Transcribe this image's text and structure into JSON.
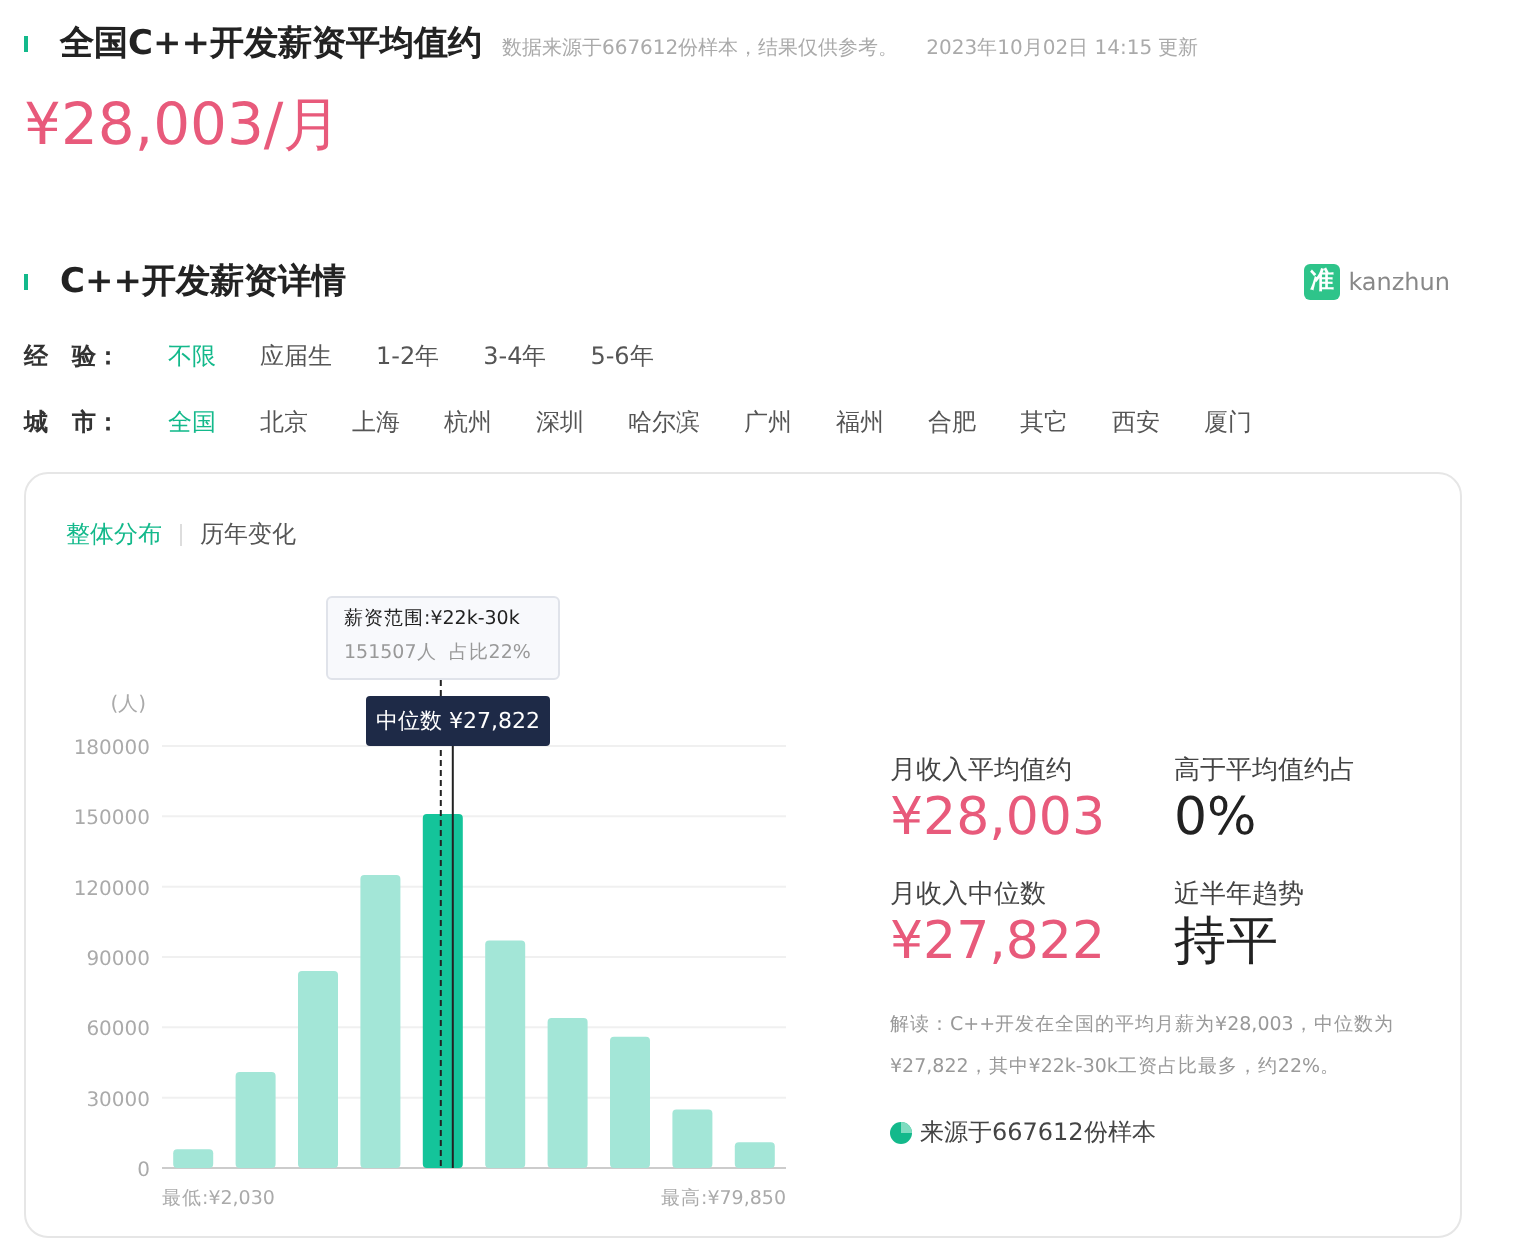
{
  "header": {
    "title": "全国C++开发薪资平均值约",
    "source_note": "数据来源于667612份样本，结果仅供参考。",
    "updated": "2023年10月02日 14:15 更新",
    "salary": "¥28,003/月"
  },
  "details": {
    "title": "C++开发薪资详情",
    "brand_icon": "准",
    "brand": "kanzhun",
    "filters": [
      {
        "label": "经　验：",
        "options": [
          {
            "label": "不限",
            "selected": true
          },
          {
            "label": "应届生",
            "selected": false
          },
          {
            "label": "1-2年",
            "selected": false
          },
          {
            "label": "3-4年",
            "selected": false
          },
          {
            "label": "5-6年",
            "selected": false
          }
        ]
      },
      {
        "label": "城　市：",
        "options": [
          {
            "label": "全国",
            "selected": true
          },
          {
            "label": "北京",
            "selected": false
          },
          {
            "label": "上海",
            "selected": false
          },
          {
            "label": "杭州",
            "selected": false
          },
          {
            "label": "深圳",
            "selected": false
          },
          {
            "label": "哈尔滨",
            "selected": false
          },
          {
            "label": "广州",
            "selected": false
          },
          {
            "label": "福州",
            "selected": false
          },
          {
            "label": "合肥",
            "selected": false
          },
          {
            "label": "其它",
            "selected": false
          },
          {
            "label": "西安",
            "selected": false
          },
          {
            "label": "厦门",
            "selected": false
          }
        ]
      }
    ]
  },
  "card": {
    "tabs": [
      {
        "label": "整体分布",
        "selected": true
      },
      {
        "label": "历年变化",
        "selected": false
      }
    ],
    "distribution": {
      "tooltip_title": "薪资范围:¥22k-30k",
      "tooltip_detail": "151507人  占比22%",
      "median_label": "中位数 ¥27,822",
      "min_label": "最低:¥2,030",
      "max_label": "最高:¥79,850",
      "chart_data": {
        "type": "bar",
        "ylabel": "(人)",
        "values": [
          8000,
          41000,
          84000,
          125000,
          151000,
          97000,
          64000,
          56000,
          25000,
          11000
        ],
        "ylim": [
          0,
          180000
        ],
        "yticks": [
          0,
          30000,
          60000,
          90000,
          120000,
          150000,
          180000
        ],
        "grid": true
      }
    },
    "stats": [
      {
        "label": "月收入平均值约",
        "value": "¥28,003",
        "kind": "money"
      },
      {
        "label": "高于平均值约占",
        "value": "0%",
        "kind": "plain"
      },
      {
        "label": "月收入中位数",
        "value": "¥27,822",
        "kind": "money"
      },
      {
        "label": "近半年趋势",
        "value": "持平",
        "kind": "plain"
      }
    ],
    "explanation": "解读：C++开发在全国的平均月薪为¥28,003，中位数为¥27,822，其中¥22k-30k工资占比最多，约22%。",
    "sample_note": "来源于667612份样本"
  }
}
